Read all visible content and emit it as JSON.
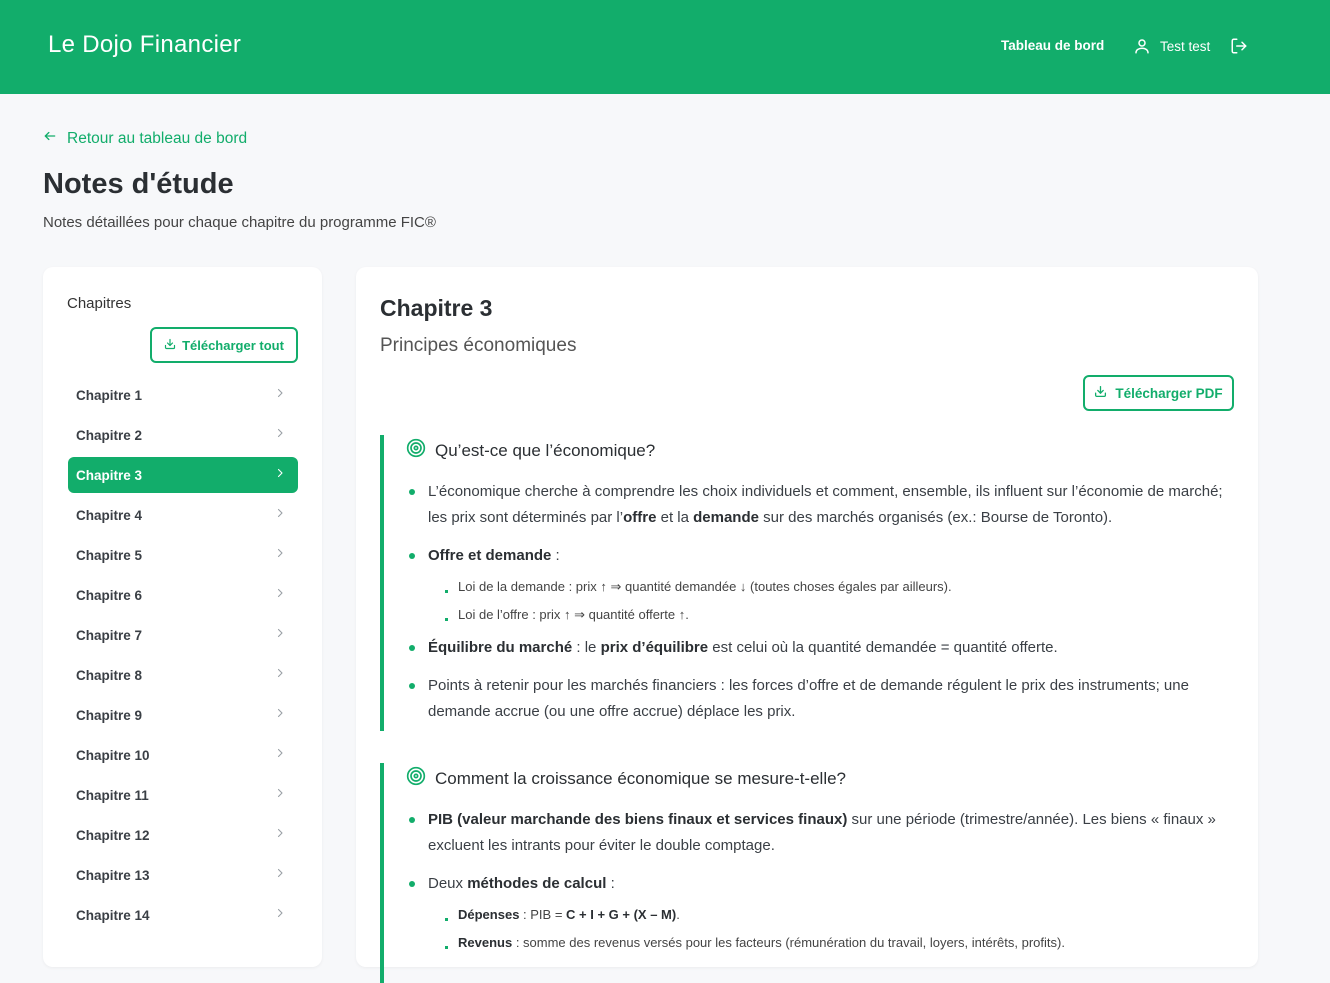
{
  "header": {
    "brand": "Le Dojo Financier",
    "nav_dashboard": "Tableau de bord",
    "user_name": "Test test",
    "accent_color": "#12ad6b"
  },
  "page": {
    "back_link": "Retour au tableau de bord",
    "title": "Notes d'étude",
    "subtitle": "Notes détaillées pour chaque chapitre du programme FIC®"
  },
  "sidebar": {
    "title": "Chapitres",
    "download_all": "Télécharger tout",
    "active_index": 2,
    "chapters": [
      "Chapitre 1",
      "Chapitre 2",
      "Chapitre 3",
      "Chapitre 4",
      "Chapitre 5",
      "Chapitre 6",
      "Chapitre 7",
      "Chapitre 8",
      "Chapitre 9",
      "Chapitre 10",
      "Chapitre 11",
      "Chapitre 12",
      "Chapitre 13",
      "Chapitre 14"
    ]
  },
  "content": {
    "chapter_title": "Chapitre 3",
    "chapter_subtitle": "Principes économiques",
    "download_pdf": "Télécharger PDF",
    "sections": [
      {
        "heading": "Qu’est-ce que l’économique?",
        "b1_t1": "L’économique cherche à comprendre les choix individuels et comment, ensemble, ils influent sur l’économie de marché; les prix sont déterminés par l’",
        "b1_b1": "offre",
        "b1_t2": " et la ",
        "b1_b2": "demande",
        "b1_t3": " sur des marchés organisés (ex.: Bourse de Toronto).",
        "b2_b1": "Offre et demande",
        "b2_t1": " :",
        "b2_sub1": "Loi de la demande : prix ↑ ⇒ quantité demandée ↓ (toutes choses égales par ailleurs).",
        "b2_sub2": "Loi de l’offre : prix ↑ ⇒ quantité offerte ↑.",
        "b3_b1": "Équilibre du marché",
        "b3_t1": " : le ",
        "b3_b2": "prix d’équilibre",
        "b3_t2": " est celui où la quantité demandée = quantité offerte.",
        "b4_t1": "Points à retenir pour les marchés financiers : les forces d’offre et de demande régulent le prix des instruments; une demande accrue (ou une offre accrue) déplace les prix."
      },
      {
        "heading": "Comment la croissance économique se mesure-t-elle?",
        "b1_b1": "PIB (valeur marchande des biens finaux et services finaux)",
        "b1_t1": " sur une période (trimestre/année). Les biens « finaux » excluent les intrants pour éviter le double comptage.",
        "b2_t1": "Deux ",
        "b2_b1": "méthodes de calcul",
        "b2_t2": " :",
        "sub1_b1": "Dépenses",
        "sub1_t1": " : PIB = ",
        "sub1_b2": "C + I + G + (X – M)",
        "sub1_t2": ".",
        "sub2_b1": "Revenus",
        "sub2_t1": " : somme des revenus versés pour les facteurs (rémunération du travail, loyers, intérêts, profits)."
      }
    ]
  }
}
